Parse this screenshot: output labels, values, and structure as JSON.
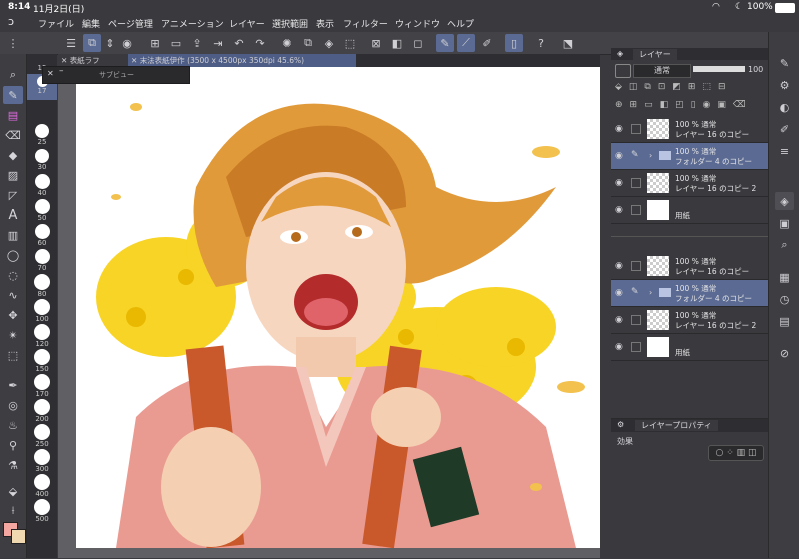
{
  "status": {
    "time": "8:14",
    "date": "11月2日(日)",
    "battery": "100%"
  },
  "menu": [
    "ファイル",
    "編集",
    "ページ管理",
    "アニメーション",
    "レイヤー",
    "選択範囲",
    "表示",
    "フィルター",
    "ウィンドウ",
    "ヘルプ"
  ],
  "tabs": [
    {
      "label": "表紙ラフ"
    },
    {
      "label": "末法表紙伊作 (3500 x 4500px 350dpi 45.6%)"
    }
  ],
  "subview": {
    "title": "サブビュー"
  },
  "brush_sizes": [
    "15",
    "17",
    "25",
    "30",
    "40",
    "50",
    "60",
    "70",
    "80",
    "100",
    "120",
    "150",
    "170",
    "200",
    "250",
    "300",
    "400",
    "500"
  ],
  "layer_panel": {
    "title": "レイヤー",
    "blend_mode": "通常",
    "opacity": "100",
    "layers": [
      {
        "percent": "100 % 通常",
        "name": "レイヤー 16 のコピー"
      },
      {
        "percent": "100 % 通常",
        "name": "フォルダー 4 のコピー"
      },
      {
        "percent": "100 % 通常",
        "name": "レイヤー 16 のコピー 2"
      },
      {
        "percent": "",
        "name": "用紙"
      },
      {
        "percent": "100 % 通常",
        "name": "レイヤー 16 のコピー"
      },
      {
        "percent": "100 % 通常",
        "name": "フォルダー 4 のコピー"
      },
      {
        "percent": "100 % 通常",
        "name": "レイヤー 16 のコピー 2"
      },
      {
        "percent": "",
        "name": "用紙"
      }
    ]
  },
  "props_panel": {
    "title": "レイヤープロパティ",
    "effect_label": "効果"
  },
  "colors": {
    "main": "#f4a6a0",
    "sub": "#f0d8b0",
    "accent": "#5a6a92"
  }
}
